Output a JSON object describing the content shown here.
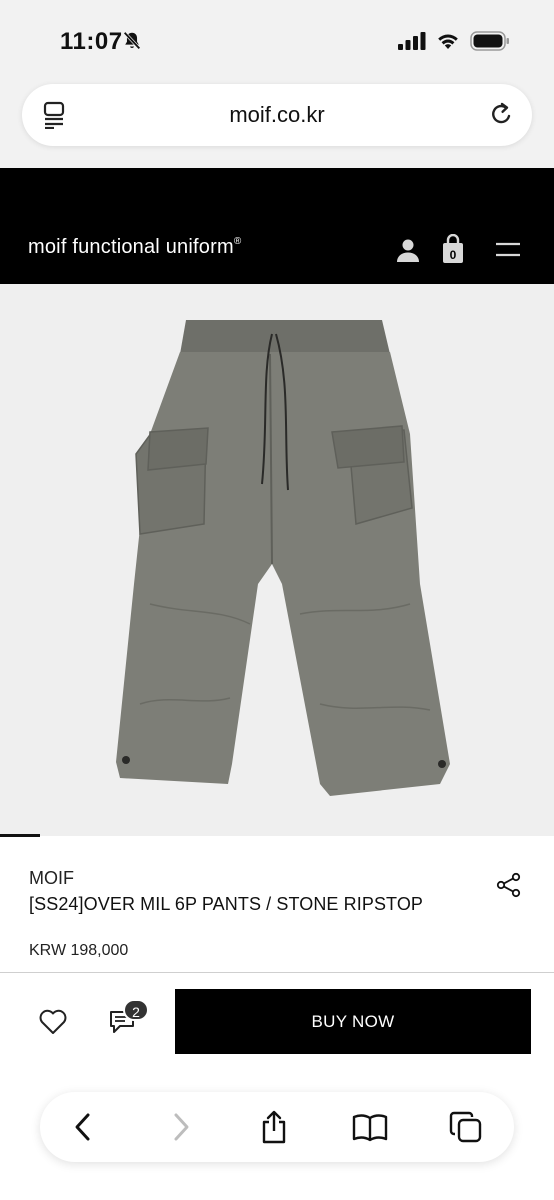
{
  "status_bar": {
    "time": "11:07",
    "icons": [
      "bell-slash-icon",
      "cellular-signal-icon",
      "wifi-icon",
      "battery-icon"
    ]
  },
  "browser": {
    "url": "moif.co.kr",
    "icons": [
      "tabs-icon",
      "reload-icon"
    ]
  },
  "site_header": {
    "brand": "moif functional uniform",
    "brand_mark": "®",
    "cart_count": "0",
    "icons": [
      "user-icon",
      "shopping-bag-icon",
      "menu-icon"
    ]
  },
  "product": {
    "image_alt": "pants-photo",
    "brand": "MOIF",
    "title": "[SS24]OVER MIL 6P PANTS / STONE RIPSTOP",
    "price": "KRW 198,000"
  },
  "actions": {
    "chat_count": "2",
    "buy_label": "BUY NOW",
    "icons": [
      "heart-icon",
      "chat-icon"
    ]
  },
  "toolbar": {
    "icons": [
      "back-icon",
      "forward-icon",
      "share-icon",
      "bookmarks-icon",
      "tabs-icon"
    ]
  },
  "colors": {
    "header_bg": "#000000",
    "buy_button_bg": "#000000",
    "image_bg": "#efefef",
    "pants_color": "#7a7b74"
  }
}
